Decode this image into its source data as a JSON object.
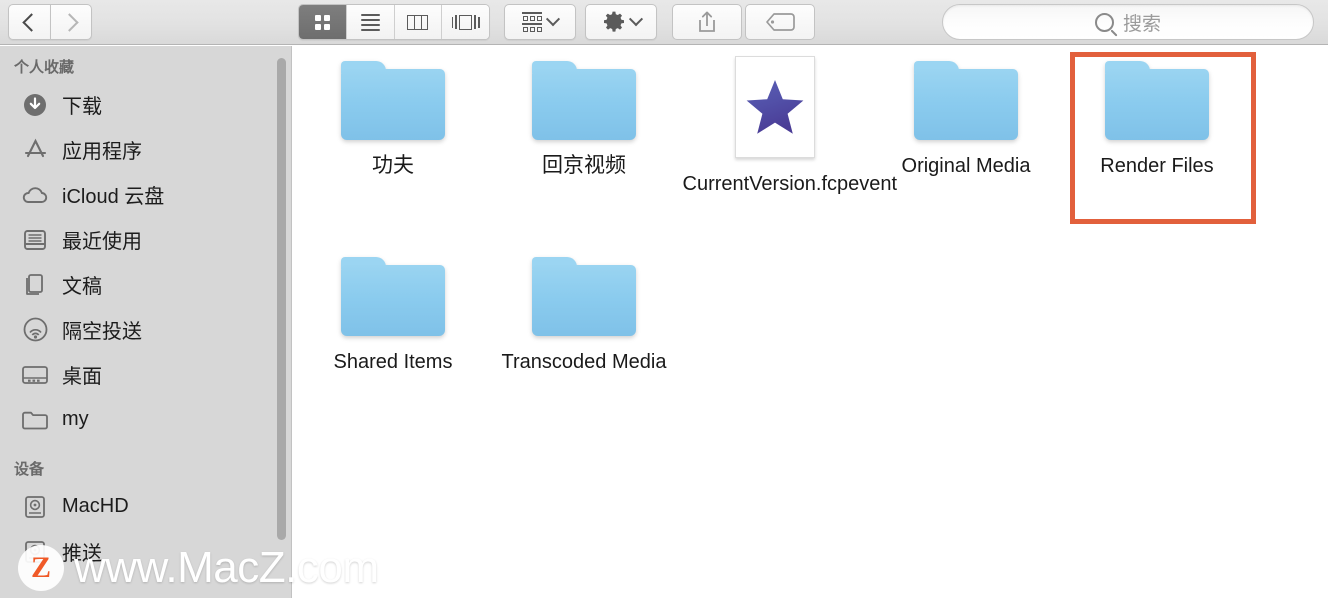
{
  "toolbar": {
    "nav": {
      "back_label": "后退",
      "back_icon": "chevron-left-icon",
      "forward_label": "前进",
      "forward_icon": "chevron-right-icon",
      "forward_disabled": true
    },
    "view_modes": [
      {
        "id": "icon",
        "icon": "grid-view-icon",
        "label": "图标显示",
        "selected": true
      },
      {
        "id": "list",
        "icon": "list-view-icon",
        "label": "列表显示",
        "selected": false
      },
      {
        "id": "column",
        "icon": "column-view-icon",
        "label": "分栏显示",
        "selected": false
      },
      {
        "id": "gallery",
        "icon": "gallery-view-icon",
        "label": "画廊显示",
        "selected": false
      }
    ],
    "arrange": {
      "icon": "arrange-by-icon",
      "label": "排列方式",
      "caret": "chevron-down-icon"
    },
    "action": {
      "icon": "gear-icon",
      "label": "操作",
      "caret": "chevron-down-icon"
    },
    "share": {
      "icon": "share-icon",
      "label": "共享"
    },
    "tags": {
      "icon": "tag-icon",
      "label": "标记"
    }
  },
  "search": {
    "icon": "search-icon",
    "placeholder": "搜索",
    "value": ""
  },
  "sidebar": {
    "sections": [
      {
        "title": "个人收藏",
        "items": [
          {
            "label": "下载",
            "icon": "download-circle-icon"
          },
          {
            "label": "应用程序",
            "icon": "applications-icon"
          },
          {
            "label": "iCloud 云盘",
            "icon": "icloud-icon"
          },
          {
            "label": "最近使用",
            "icon": "recents-icon"
          },
          {
            "label": "文稿",
            "icon": "documents-icon"
          },
          {
            "label": "隔空投送",
            "icon": "airdrop-icon"
          },
          {
            "label": "桌面",
            "icon": "desktop-icon"
          },
          {
            "label": "my",
            "icon": "folder-icon"
          }
        ]
      },
      {
        "title": "设备",
        "items": [
          {
            "label": "MacHD",
            "icon": "harddisk-icon"
          },
          {
            "label": "推送",
            "icon": "harddisk-icon"
          }
        ]
      }
    ],
    "scrollbar": "sidebar-scrollbar"
  },
  "content": {
    "items": [
      {
        "name": "功夫",
        "kind": "folder",
        "icon": "folder-icon",
        "col": 0,
        "row": 0,
        "cjk": true
      },
      {
        "name": "回京视频",
        "kind": "folder",
        "icon": "folder-icon",
        "col": 1,
        "row": 0,
        "cjk": true
      },
      {
        "name": "CurrentVersion.fcpevent",
        "kind": "document",
        "icon": "fcp-event-icon",
        "col": 2,
        "row": 0,
        "cjk": false
      },
      {
        "name": "Original Media",
        "kind": "folder",
        "icon": "folder-icon",
        "col": 3,
        "row": 0,
        "cjk": false
      },
      {
        "name": "Render Files",
        "kind": "folder",
        "icon": "folder-icon",
        "col": 4,
        "row": 0,
        "cjk": false,
        "highlighted": true
      },
      {
        "name": "Shared Items",
        "kind": "folder",
        "icon": "folder-icon",
        "col": 0,
        "row": 1,
        "cjk": false
      },
      {
        "name": "Transcoded Media",
        "kind": "folder",
        "icon": "folder-icon",
        "col": 1,
        "row": 1,
        "cjk": false
      }
    ],
    "highlight": {
      "target": "Render Files",
      "color": "#E2603C"
    }
  },
  "watermark": {
    "badge_letter": "Z",
    "text": "www.MacZ.com"
  },
  "colors": {
    "toolbar_bg": "#E2E2E2",
    "sidebar_bg": "#D7D7D7",
    "content_bg": "#FFFFFF",
    "folder_blue": "#8ACBEE",
    "highlight_orange": "#E2603C",
    "star_purple": "#4B4AA0"
  }
}
